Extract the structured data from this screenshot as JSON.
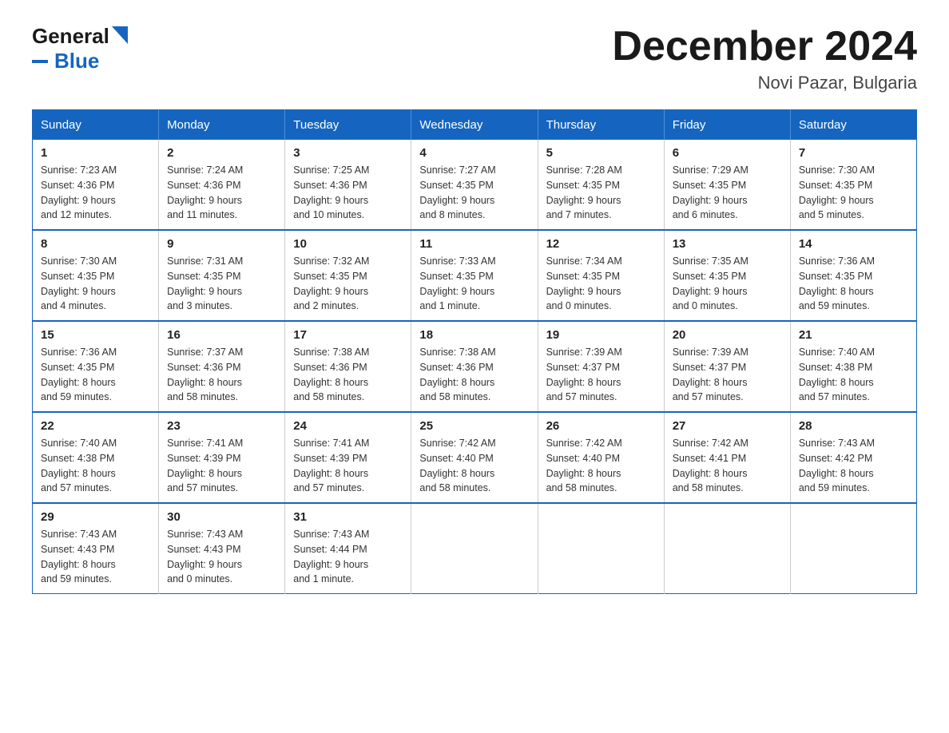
{
  "header": {
    "logo_general": "General",
    "logo_blue": "Blue",
    "title": "December 2024",
    "subtitle": "Novi Pazar, Bulgaria"
  },
  "weekdays": [
    "Sunday",
    "Monday",
    "Tuesday",
    "Wednesday",
    "Thursday",
    "Friday",
    "Saturday"
  ],
  "weeks": [
    [
      {
        "day": "1",
        "sunrise": "7:23 AM",
        "sunset": "4:36 PM",
        "daylight": "9 hours and 12 minutes."
      },
      {
        "day": "2",
        "sunrise": "7:24 AM",
        "sunset": "4:36 PM",
        "daylight": "9 hours and 11 minutes."
      },
      {
        "day": "3",
        "sunrise": "7:25 AM",
        "sunset": "4:36 PM",
        "daylight": "9 hours and 10 minutes."
      },
      {
        "day": "4",
        "sunrise": "7:27 AM",
        "sunset": "4:35 PM",
        "daylight": "9 hours and 8 minutes."
      },
      {
        "day": "5",
        "sunrise": "7:28 AM",
        "sunset": "4:35 PM",
        "daylight": "9 hours and 7 minutes."
      },
      {
        "day": "6",
        "sunrise": "7:29 AM",
        "sunset": "4:35 PM",
        "daylight": "9 hours and 6 minutes."
      },
      {
        "day": "7",
        "sunrise": "7:30 AM",
        "sunset": "4:35 PM",
        "daylight": "9 hours and 5 minutes."
      }
    ],
    [
      {
        "day": "8",
        "sunrise": "7:30 AM",
        "sunset": "4:35 PM",
        "daylight": "9 hours and 4 minutes."
      },
      {
        "day": "9",
        "sunrise": "7:31 AM",
        "sunset": "4:35 PM",
        "daylight": "9 hours and 3 minutes."
      },
      {
        "day": "10",
        "sunrise": "7:32 AM",
        "sunset": "4:35 PM",
        "daylight": "9 hours and 2 minutes."
      },
      {
        "day": "11",
        "sunrise": "7:33 AM",
        "sunset": "4:35 PM",
        "daylight": "9 hours and 1 minute."
      },
      {
        "day": "12",
        "sunrise": "7:34 AM",
        "sunset": "4:35 PM",
        "daylight": "9 hours and 0 minutes."
      },
      {
        "day": "13",
        "sunrise": "7:35 AM",
        "sunset": "4:35 PM",
        "daylight": "9 hours and 0 minutes."
      },
      {
        "day": "14",
        "sunrise": "7:36 AM",
        "sunset": "4:35 PM",
        "daylight": "8 hours and 59 minutes."
      }
    ],
    [
      {
        "day": "15",
        "sunrise": "7:36 AM",
        "sunset": "4:35 PM",
        "daylight": "8 hours and 59 minutes."
      },
      {
        "day": "16",
        "sunrise": "7:37 AM",
        "sunset": "4:36 PM",
        "daylight": "8 hours and 58 minutes."
      },
      {
        "day": "17",
        "sunrise": "7:38 AM",
        "sunset": "4:36 PM",
        "daylight": "8 hours and 58 minutes."
      },
      {
        "day": "18",
        "sunrise": "7:38 AM",
        "sunset": "4:36 PM",
        "daylight": "8 hours and 58 minutes."
      },
      {
        "day": "19",
        "sunrise": "7:39 AM",
        "sunset": "4:37 PM",
        "daylight": "8 hours and 57 minutes."
      },
      {
        "day": "20",
        "sunrise": "7:39 AM",
        "sunset": "4:37 PM",
        "daylight": "8 hours and 57 minutes."
      },
      {
        "day": "21",
        "sunrise": "7:40 AM",
        "sunset": "4:38 PM",
        "daylight": "8 hours and 57 minutes."
      }
    ],
    [
      {
        "day": "22",
        "sunrise": "7:40 AM",
        "sunset": "4:38 PM",
        "daylight": "8 hours and 57 minutes."
      },
      {
        "day": "23",
        "sunrise": "7:41 AM",
        "sunset": "4:39 PM",
        "daylight": "8 hours and 57 minutes."
      },
      {
        "day": "24",
        "sunrise": "7:41 AM",
        "sunset": "4:39 PM",
        "daylight": "8 hours and 57 minutes."
      },
      {
        "day": "25",
        "sunrise": "7:42 AM",
        "sunset": "4:40 PM",
        "daylight": "8 hours and 58 minutes."
      },
      {
        "day": "26",
        "sunrise": "7:42 AM",
        "sunset": "4:40 PM",
        "daylight": "8 hours and 58 minutes."
      },
      {
        "day": "27",
        "sunrise": "7:42 AM",
        "sunset": "4:41 PM",
        "daylight": "8 hours and 58 minutes."
      },
      {
        "day": "28",
        "sunrise": "7:43 AM",
        "sunset": "4:42 PM",
        "daylight": "8 hours and 59 minutes."
      }
    ],
    [
      {
        "day": "29",
        "sunrise": "7:43 AM",
        "sunset": "4:43 PM",
        "daylight": "8 hours and 59 minutes."
      },
      {
        "day": "30",
        "sunrise": "7:43 AM",
        "sunset": "4:43 PM",
        "daylight": "9 hours and 0 minutes."
      },
      {
        "day": "31",
        "sunrise": "7:43 AM",
        "sunset": "4:44 PM",
        "daylight": "9 hours and 1 minute."
      },
      null,
      null,
      null,
      null
    ]
  ],
  "labels": {
    "sunrise": "Sunrise:",
    "sunset": "Sunset:",
    "daylight": "Daylight:"
  }
}
